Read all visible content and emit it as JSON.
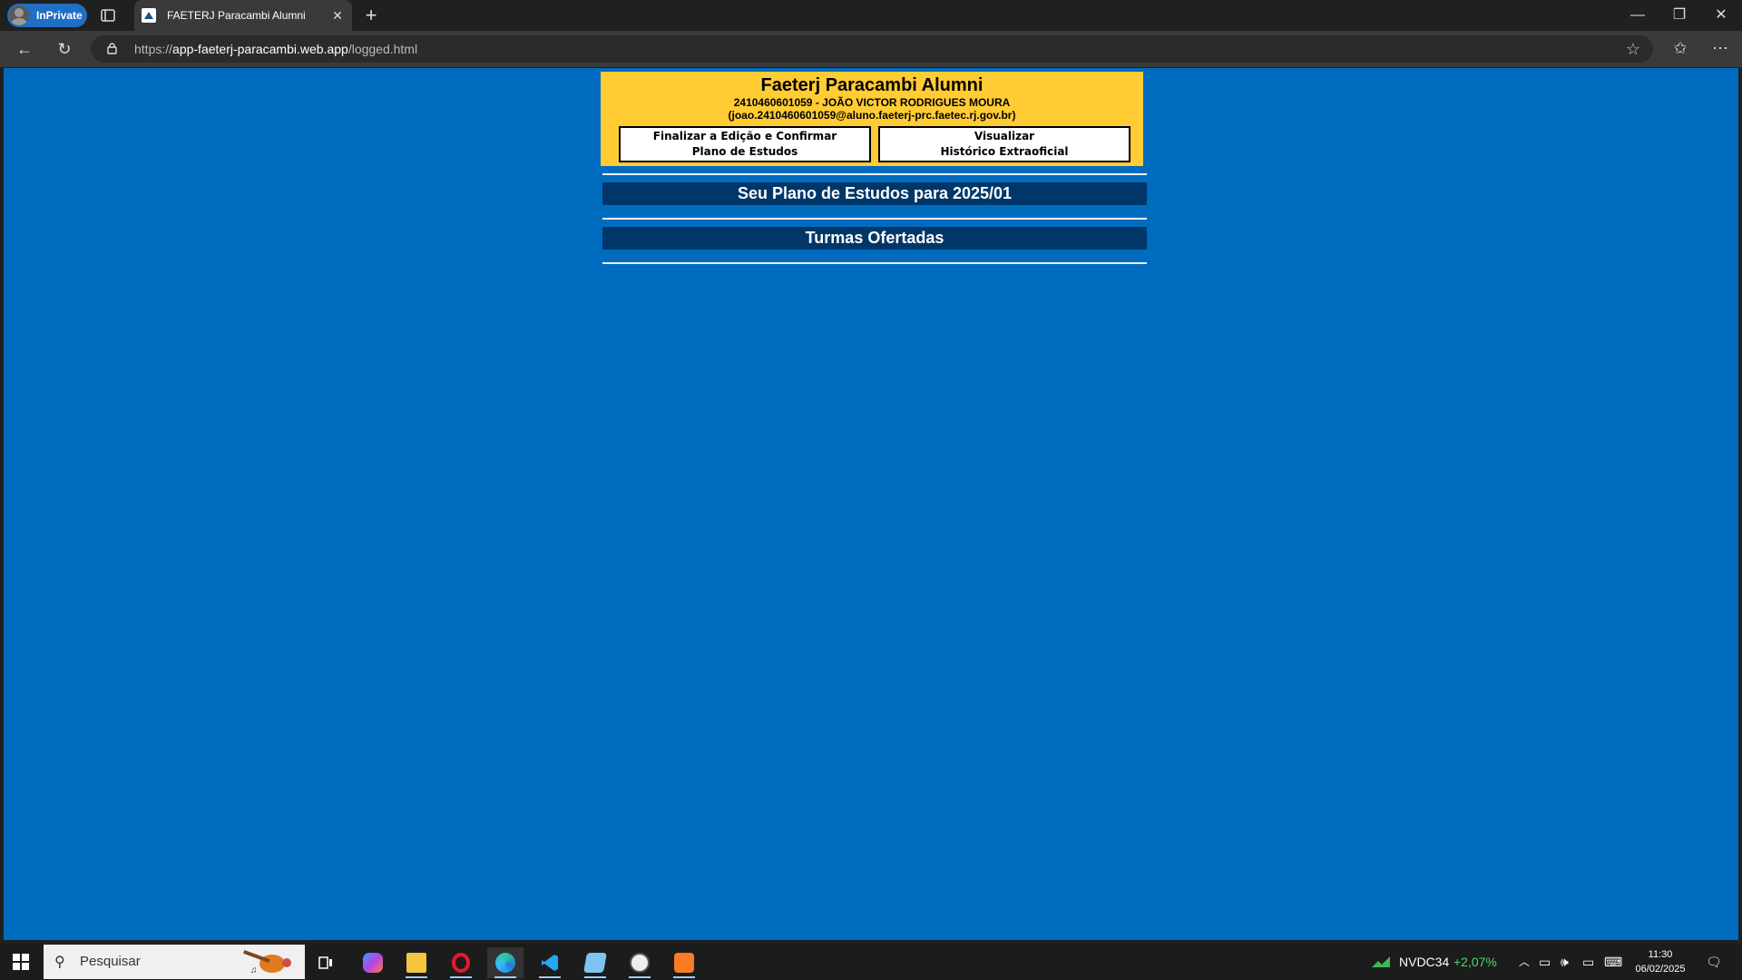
{
  "browser": {
    "inprivate_label": "InPrivate",
    "tab_title": "FAETERJ Paracambi Alumni",
    "url_scheme": "https://",
    "url_host": "app-faeterj-paracambi.web.app",
    "url_path": "/logged.html"
  },
  "page": {
    "title": "Faeterj Paracambi Alumni",
    "student_line": "2410460601059 - JOÃO VICTOR RODRIGUES MOURA",
    "email_line": "(joao.2410460601059@aluno.faeterj-prc.faetec.rj.gov.br)",
    "btn_finalize_line1": "Finalizar a Edição e Confirmar",
    "btn_finalize_line2": "Plano de Estudos",
    "btn_history_line1": "Visualizar",
    "btn_history_line2": "Histórico Extraoficial",
    "section_plan": "Seu Plano de Estudos para 2025/01",
    "section_classes": "Turmas Ofertadas"
  },
  "taskbar": {
    "search_placeholder": "Pesquisar",
    "stock_symbol": "NVDC34",
    "stock_change": "+2,07%",
    "time": "11:30",
    "date": "06/02/2025"
  },
  "colors": {
    "page_bg": "#006cc0",
    "header_bg": "#ffcc33",
    "section_bg": "#003768",
    "stock_up": "#4cd964"
  },
  "icons": [
    "inprivate-avatar-icon",
    "tab-actions-icon",
    "tab-favicon-icon",
    "close-tab-icon",
    "new-tab-icon",
    "minimize-icon",
    "restore-icon",
    "window-close-icon",
    "back-icon",
    "refresh-icon",
    "lock-icon",
    "favorite-star-icon",
    "favorites-icon",
    "more-icon",
    "windows-start-icon",
    "search-icon",
    "task-view-icon",
    "copilot-icon",
    "file-explorer-icon",
    "opera-icon",
    "edge-icon",
    "vscode-icon",
    "notepad-icon",
    "clock-app-icon",
    "xampp-icon",
    "stock-chart-icon",
    "tray-chevron-icon",
    "meet-now-icon",
    "volume-icon",
    "network-icon",
    "keyboard-icon",
    "notifications-icon"
  ]
}
